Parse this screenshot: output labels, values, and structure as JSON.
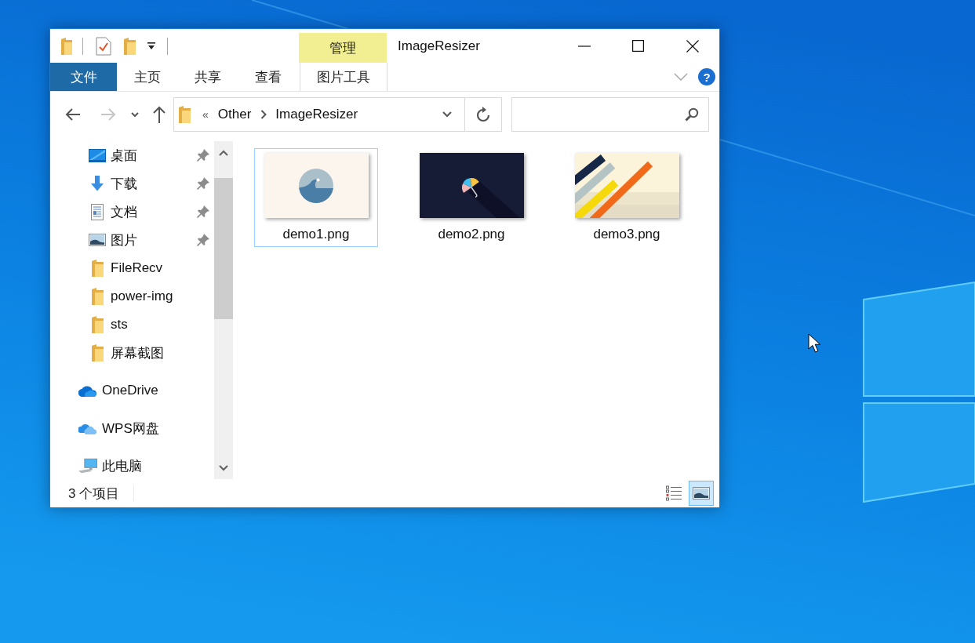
{
  "window": {
    "title": "ImageResizer"
  },
  "ribbon": {
    "tabs": [
      {
        "label": "文件",
        "kind": "file_menu"
      },
      {
        "label": "主页",
        "kind": "tab"
      },
      {
        "label": "共享",
        "kind": "tab"
      },
      {
        "label": "查看",
        "kind": "tab"
      },
      {
        "label": "图片工具",
        "kind": "context",
        "group": "管理"
      }
    ],
    "help": "?"
  },
  "navigation": {
    "buttons": [
      {
        "kind": "back",
        "disabled": false
      },
      {
        "kind": "forward",
        "disabled": true
      },
      {
        "kind": "recent",
        "disabled": false
      },
      {
        "kind": "up",
        "disabled": false
      }
    ]
  },
  "address_bar": {
    "overflow": "«",
    "path": [
      "Other",
      "ImageResizer"
    ]
  },
  "sidebar": {
    "items": [
      {
        "label": "桌面",
        "kind": "desktop",
        "pinned": true
      },
      {
        "label": "下载",
        "kind": "download",
        "pinned": true
      },
      {
        "label": "文档",
        "kind": "document",
        "pinned": true
      },
      {
        "label": "图片",
        "kind": "picture",
        "pinned": true
      },
      {
        "label": "FileRecv",
        "kind": "folder",
        "pinned": false
      },
      {
        "label": "power-img",
        "kind": "folder",
        "pinned": false
      },
      {
        "label": "sts",
        "kind": "folder",
        "pinned": false
      },
      {
        "label": "屏幕截图",
        "kind": "folder",
        "pinned": false
      }
    ],
    "locations": [
      {
        "label": "OneDrive",
        "kind": "onedrive"
      },
      {
        "label": "WPS网盘",
        "kind": "wps_cloud"
      },
      {
        "label": "此电脑",
        "kind": "computer"
      }
    ]
  },
  "files": [
    {
      "name": "demo1.png",
      "kind": "wave",
      "selected": true
    },
    {
      "name": "demo2.png",
      "kind": "umbrella",
      "selected": false
    },
    {
      "name": "demo3.png",
      "kind": "stripes",
      "selected": false
    }
  ],
  "status_bar": {
    "item_count": "3 个项目",
    "views": [
      {
        "kind": "details",
        "selected": false
      },
      {
        "kind": "large_icons",
        "selected": true
      }
    ]
  }
}
